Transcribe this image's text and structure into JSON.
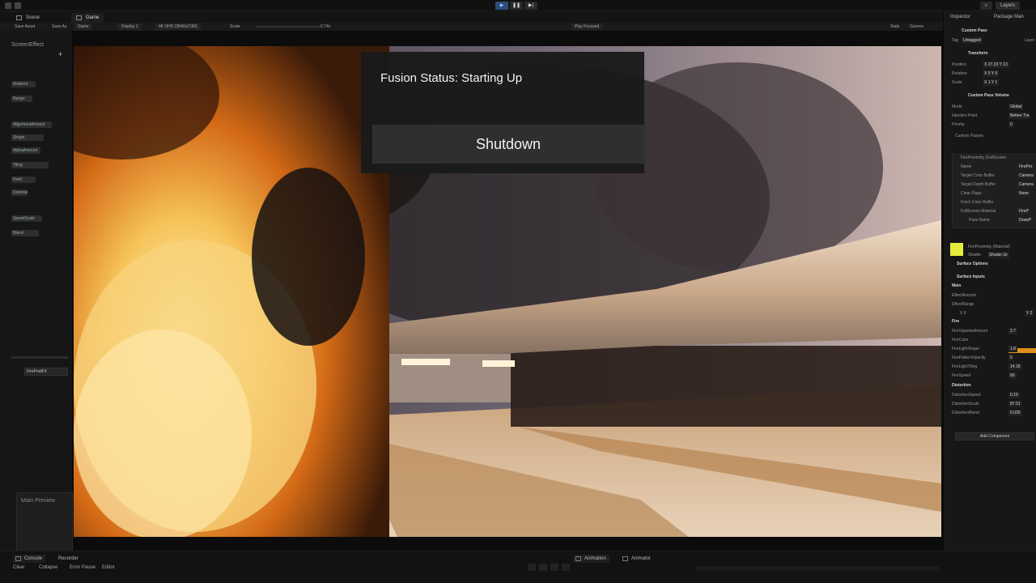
{
  "toolbar": {
    "play_icon": "play-icon",
    "pause_icon": "pause-icon",
    "step_icon": "step-icon",
    "layers_label": "Layers"
  },
  "tabs": {
    "scene": "Scene",
    "game": "Game",
    "inspector": "Inspector",
    "package_manager": "Package Man"
  },
  "game_toolbar": {
    "save_asset": "Save Asset",
    "save_as": "Save As",
    "game_mode": "Game",
    "display": "Display 1",
    "resolution": "4K UHD (3840x2160)",
    "scale_label": "Scale",
    "scale_value": "0.74x",
    "play_focused": "Play Focused",
    "stats": "Stats",
    "gizmos": "Gizmos"
  },
  "left_panel": {
    "header": "ScreenEffect",
    "items": [
      "Ambient",
      "Range",
      "AlignmentAmount",
      "Shape",
      "AlphaAmount",
      "Tiling",
      "Field",
      "Distortion",
      "SpeedScale",
      "Blend"
    ],
    "search_value": "FirePostFX",
    "preview_title": "Main Preview"
  },
  "game_ui": {
    "status_text": "Fusion Status: Starting Up",
    "shutdown_label": "Shutdown"
  },
  "inspector": {
    "custom_pass_title": "Custom Pass",
    "tag_label": "Tag",
    "tag_value": "Untagged",
    "layer_label": "Layer",
    "transform_title": "Transform",
    "position_label": "Position",
    "position_value": "X 27.23  Y 13",
    "rotation_label": "Rotation",
    "rotation_value": "X 0  Y 0",
    "scale_label": "Scale",
    "scale_value": "X 1  Y 1",
    "volume_title": "Custom Pass Volume",
    "mode_label": "Mode",
    "mode_value": "Global",
    "injection_label": "Injection Point",
    "injection_value": "Before Tra",
    "priority_label": "Priority",
    "priority_value": "0",
    "custom_passes_label": "Custom Passes",
    "pass_name": "FireProximity (FullScreen",
    "pass_rows": [
      {
        "k": "Name",
        "v": "FirePro"
      },
      {
        "k": "Target Color Buffer",
        "v": "Camera"
      },
      {
        "k": "Target Depth Buffer",
        "v": "Camera"
      },
      {
        "k": "Clear Flags",
        "v": "None"
      },
      {
        "k": "Fetch Color Buffer",
        "v": ""
      },
      {
        "k": "FullScreen Material",
        "v": "FireP"
      },
      {
        "k": "Pass Name",
        "v": "DrawP"
      }
    ],
    "material_name": "FireProximity (Material)",
    "shader_label": "Shader",
    "shader_value": "Shader Gr",
    "surface_options": "Surface Options",
    "surface_inputs": "Surface Inputs",
    "main_label": "Main",
    "main_rows": [
      {
        "k": "EffectAmount",
        "v": ""
      },
      {
        "k": "EffectRange",
        "v": ""
      },
      {
        "k": "X 0",
        "v": "Y 2"
      }
    ],
    "fire_label": "Fire",
    "fire_rows": [
      {
        "k": "FireVignetteAmount",
        "v": "2.7"
      },
      {
        "k": "FireColor",
        "v": ""
      },
      {
        "k": "FireLightShape",
        "v": "1.8"
      },
      {
        "k": "FirePatternOpacity",
        "v": "5"
      },
      {
        "k": "FireLightTiling",
        "v": "14.16"
      },
      {
        "k": "FireSpeed",
        "v": "60"
      }
    ],
    "distortion_label": "Distortion",
    "distortion_rows": [
      {
        "k": "DistortionSpeed",
        "v": "0.15"
      },
      {
        "k": "DistortionScale",
        "v": "87.01"
      },
      {
        "k": "DistortionBlend",
        "v": "0.035"
      }
    ],
    "add_component": "Add Component",
    "fire_color": "#e0901a",
    "material_swatch": "#e6ec3c"
  },
  "bottom": {
    "console_tab": "Console",
    "recorder_tab": "Recorder",
    "clear": "Clear",
    "collapse": "Collapse",
    "error_pause": "Error Pause",
    "editor": "Editor",
    "animation_tab": "Animation",
    "animator_tab": "Animator"
  }
}
